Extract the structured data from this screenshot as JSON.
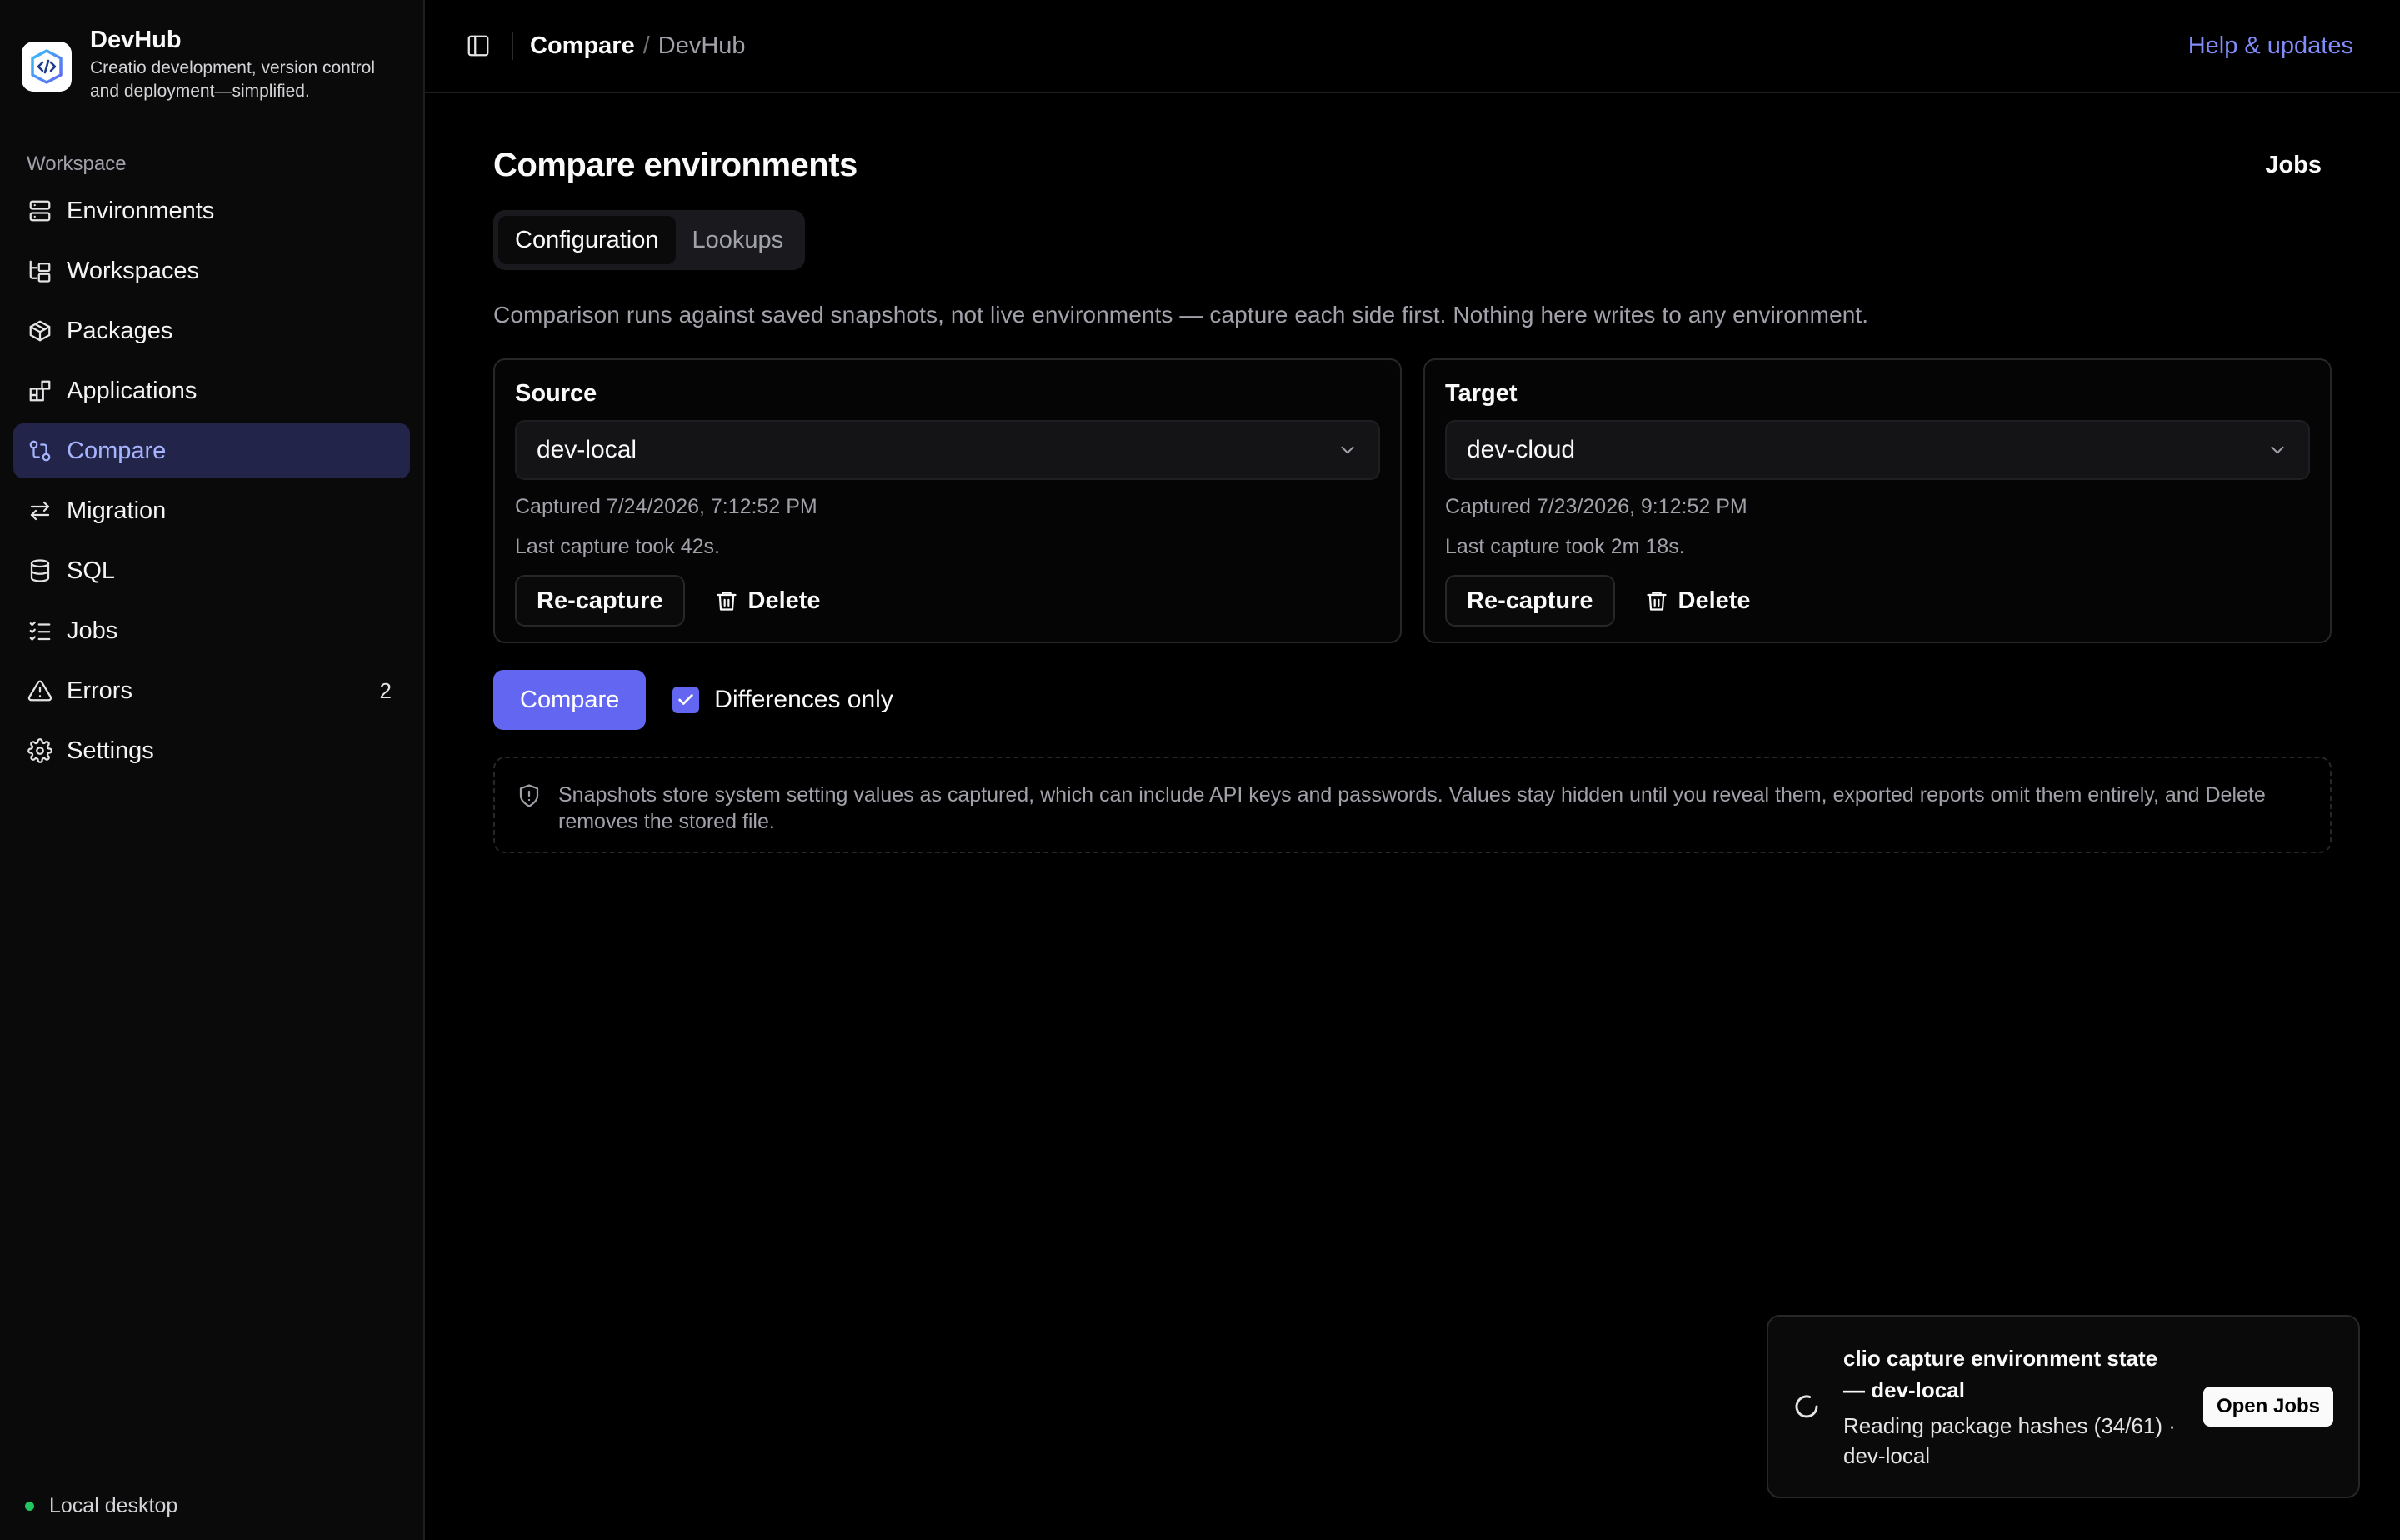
{
  "app": {
    "name": "DevHub",
    "tagline": "Creatio development, version control and deployment—simplified."
  },
  "sidebar": {
    "section_label": "Workspace",
    "items": [
      {
        "label": "Environments",
        "icon": "server-icon"
      },
      {
        "label": "Workspaces",
        "icon": "folder-tree-icon"
      },
      {
        "label": "Packages",
        "icon": "package-icon"
      },
      {
        "label": "Applications",
        "icon": "blocks-icon"
      },
      {
        "label": "Compare",
        "icon": "git-compare-icon",
        "active": true
      },
      {
        "label": "Migration",
        "icon": "arrows-swap-icon"
      },
      {
        "label": "SQL",
        "icon": "database-icon"
      },
      {
        "label": "Jobs",
        "icon": "list-checks-icon"
      },
      {
        "label": "Errors",
        "icon": "warning-triangle-icon",
        "badge": "2"
      },
      {
        "label": "Settings",
        "icon": "gear-icon"
      }
    ],
    "footer_status": "Local desktop",
    "footer_status_color": "#22c55e"
  },
  "topbar": {
    "breadcrumb_current": "Compare",
    "breadcrumb_separator": "/",
    "breadcrumb_root": "DevHub",
    "help_link": "Help & updates"
  },
  "page": {
    "title": "Compare environments",
    "jobs_button": "Jobs",
    "tabs": [
      {
        "label": "Configuration",
        "active": true
      },
      {
        "label": "Lookups",
        "active": false
      }
    ],
    "description": "Comparison runs against saved snapshots, not live environments — capture each side first. Nothing here writes to any environment."
  },
  "source": {
    "label": "Source",
    "selected": "dev-local",
    "captured": "Captured 7/24/2026, 7:12:52 PM",
    "duration": "Last capture took 42s.",
    "recapture_label": "Re-capture",
    "delete_label": "Delete"
  },
  "target": {
    "label": "Target",
    "selected": "dev-cloud",
    "captured": "Captured 7/23/2026, 9:12:52 PM",
    "duration": "Last capture took 2m 18s.",
    "recapture_label": "Re-capture",
    "delete_label": "Delete"
  },
  "compare": {
    "button_label": "Compare",
    "differences_only_label": "Differences only",
    "differences_only_checked": true
  },
  "notice": {
    "text": "Snapshots store system setting values as captured, which can include API keys and passwords. Values stay hidden until you reveal them, exported reports omit them entirely, and Delete removes the stored file."
  },
  "toast": {
    "title": "clio capture environment state — dev-local",
    "message": "Reading package hashes (34/61) · dev-local",
    "button_label": "Open Jobs"
  },
  "colors": {
    "accent": "#6366f1",
    "accent_text": "#818cf8",
    "active_nav_bg": "#23244a",
    "background": "#000000"
  }
}
